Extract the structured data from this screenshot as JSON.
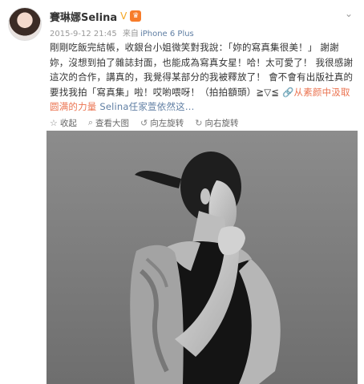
{
  "author": {
    "name": "賽琳娜Selina"
  },
  "meta": {
    "time": "2015-9-12 21:45",
    "source_prefix": "来自",
    "source": "iPhone 6 Plus"
  },
  "post": {
    "text": "剛剛吃飯完結帳，收銀台小姐微笑對我說：「妳的寫真集很美！」 謝謝妳，沒想到拍了雜誌封面，也能成為寫真女星！哈！太可愛了！ 我很感謝這次的合作，講真的，我覺得某部分的我被釋放了！ 會不會有出版社真的要找我拍「寫真集」啦！哎喲喂呀！（拍拍額頭）≧▽≦ ",
    "link_icon": "🔗",
    "link": "从素颜中汲取圆满的力量",
    "topic": "Selina任家萱依然这..."
  },
  "actions": [
    {
      "icon": "star-icon",
      "glyph": "☆",
      "label": "收起"
    },
    {
      "icon": "magnify-icon",
      "glyph": "⌕",
      "label": "查看大图"
    },
    {
      "icon": "rotate-left-icon",
      "glyph": "↺",
      "label": "向左旋转"
    },
    {
      "icon": "rotate-right-icon",
      "glyph": "↻",
      "label": "向右旋转"
    }
  ],
  "colors": {
    "link": "#eb7350",
    "topic": "#5f7ea3",
    "meta": "#999999",
    "photo_bg": "#7d7d7d"
  }
}
